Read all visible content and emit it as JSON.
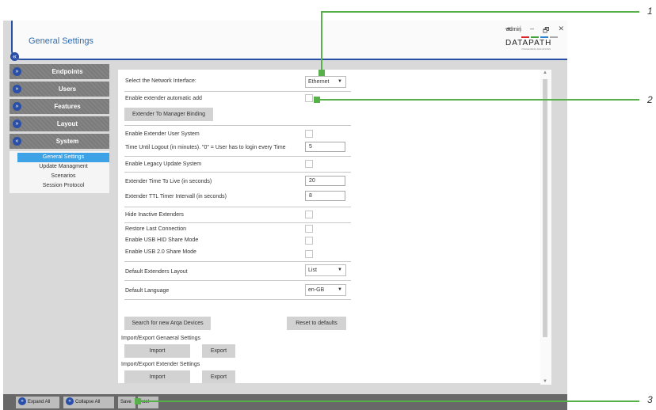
{
  "header": {
    "title": "General Settings",
    "user": "admin",
    "window_buttons": [
      "⇥",
      "|",
      "–",
      "🗗",
      "✕"
    ],
    "logo_text": "DATAPATH",
    "logo_tagline": "VISUALISING SOLUTIONS",
    "logo_colors": [
      "#d6262b",
      "#3ea13a",
      "#2d7fd0",
      "#a9a9a9"
    ]
  },
  "sidebar": {
    "toggle_icon": "«",
    "sections": [
      {
        "label": "Endpoints",
        "icon": "»",
        "expanded": false
      },
      {
        "label": "Users",
        "icon": "»",
        "expanded": false
      },
      {
        "label": "Features",
        "icon": "»",
        "expanded": false
      },
      {
        "label": "Layout",
        "icon": "»",
        "expanded": false
      },
      {
        "label": "System",
        "icon": "«",
        "expanded": true
      }
    ],
    "system_items": [
      {
        "label": "General Settings",
        "active": true
      },
      {
        "label": "Update Managment",
        "active": false
      },
      {
        "label": "Scenarios",
        "active": false
      },
      {
        "label": "Session Protocol",
        "active": false
      }
    ]
  },
  "settings": {
    "network_interface_label": "Select the Network Interface:",
    "network_interface_value": "Ethernet",
    "auto_add_label": "Enable extender automatic add",
    "binding_button": "Extender To Manager Binding",
    "user_system_label": "Enable Extender User System",
    "logout_label": "Time Until Logout (in minutes). \"0\" = User has to login every Time",
    "logout_value": "5",
    "legacy_update_label": "Enable Legacy Update System",
    "ttl_label": "Extender Time To Live (in seconds)",
    "ttl_value": "20",
    "ttl_timer_label": "Extender TTL Timer Intervall (in seconds)",
    "ttl_timer_value": "8",
    "hide_inactive_label": "Hide Inactive Extenders",
    "restore_label": "Restore Last Connection",
    "usb_hid_label": "Enable USB HID Share Mode",
    "usb20_label": "Enable USB 2.0 Share Mode",
    "layout_label": "Default Extenders Layout",
    "layout_value": "List",
    "language_label": "Default Language",
    "language_value": "en-GB",
    "search_button": "Search for new Arqa Devices",
    "reset_button": "Reset to defaults",
    "general_group": "Import/Export Genaeral Settings",
    "extender_group": "Import/Export Extender Settings",
    "import_label": "Import",
    "export_label": "Export",
    "caret": "▼"
  },
  "scrollbar": {
    "up": "▲",
    "down": "▼"
  },
  "bottombar": {
    "expand_all": "Expand All",
    "collapse_all": "Collapse All",
    "save": "Save",
    "cancel_partial": "ncel",
    "expand_icon": "»",
    "collapse_icon": "«"
  },
  "callouts": [
    "1",
    "2",
    "3"
  ]
}
